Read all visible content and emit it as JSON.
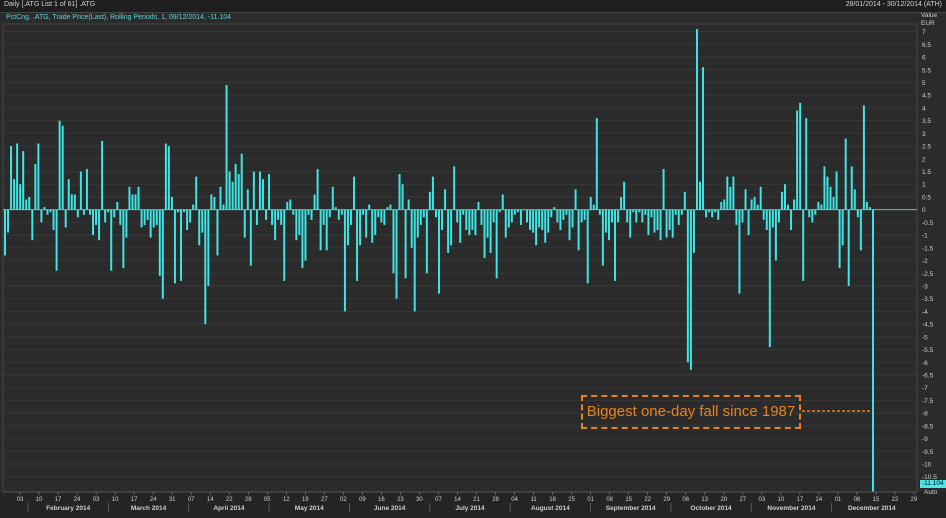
{
  "header": {
    "left": "Daily [.ATG List 1 of 61] .ATG",
    "right": "28/01/2014 - 30/12/2014 (ATH)"
  },
  "subtitle": "PctCng, .ATG, Trade Price(Last), Rolling Periods, 1, 09/12/2014, -11.104",
  "annotation": "Biggest one-day fall since 1987",
  "value_badge": "-11.104",
  "auto_label": "Auto",
  "colors": {
    "bar": "#3ee6e6",
    "background": "#2b2b2b",
    "grid": "#3a3a3a",
    "annotation": "#e8821e"
  },
  "chart_data": {
    "type": "bar",
    "ylabel": "Value EUR",
    "ylim": [
      -11.1,
      7.3
    ],
    "yticks": [
      7,
      6.5,
      6,
      5.5,
      5,
      4.5,
      4,
      3.5,
      3,
      2.5,
      2,
      1.5,
      1,
      0.5,
      0,
      -0.5,
      -1,
      -1.5,
      -2,
      -2.5,
      -3,
      -3.5,
      -4,
      -4.5,
      -5,
      -5.5,
      -6,
      -6.5,
      -7,
      -7.5,
      -8,
      -8.5,
      -9,
      -9.5,
      -10,
      -10.5
    ],
    "day_ticks": [
      "03",
      "10",
      "17",
      "24",
      "03",
      "10",
      "17",
      "24",
      "31",
      "07",
      "14",
      "22",
      "28",
      "05",
      "12",
      "19",
      "27",
      "02",
      "09",
      "16",
      "23",
      "30",
      "07",
      "14",
      "21",
      "28",
      "04",
      "11",
      "18",
      "25",
      "01",
      "08",
      "15",
      "22",
      "29",
      "06",
      "13",
      "20",
      "27",
      "03",
      "10",
      "17",
      "24",
      "01",
      "08",
      "15",
      "22",
      "29"
    ],
    "months": [
      "February 2014",
      "March 2014",
      "April 2014",
      "May 2014",
      "June 2014",
      "July 2014",
      "August 2014",
      "September 2014",
      "October 2014",
      "November 2014",
      "December 2014"
    ],
    "values": [
      -1.8,
      -0.9,
      2.5,
      1.2,
      2.6,
      1.0,
      2.3,
      0.4,
      0.5,
      -1.2,
      1.8,
      2.6,
      -0.5,
      0.1,
      -0.2,
      -0.1,
      -0.8,
      -2.4,
      3.5,
      3.3,
      -0.7,
      1.2,
      0.6,
      0.6,
      -0.3,
      1.5,
      -0.2,
      1.6,
      -0.2,
      -1.0,
      -0.6,
      -1.2,
      2.7,
      -0.5,
      -0.1,
      -2.4,
      -0.3,
      0.3,
      -0.6,
      -2.3,
      -1.1,
      0.9,
      0.6,
      0.6,
      0.9,
      -0.7,
      -0.6,
      -0.4,
      -1.1,
      -0.7,
      -0.6,
      -2.6,
      -3.5,
      2.6,
      2.5,
      0.5,
      -2.9,
      -0.1,
      -2.8,
      -0.1,
      -0.8,
      -0.5,
      0.2,
      1.3,
      -1.4,
      -0.9,
      -4.5,
      -3.0,
      0.6,
      0.5,
      -1.8,
      0.9,
      0.2,
      4.9,
      1.5,
      1.1,
      1.8,
      1.4,
      2.2,
      -1.1,
      0.8,
      -2.2,
      1.5,
      -0.6,
      1.5,
      1.2,
      -0.4,
      1.4,
      -0.6,
      -1.2,
      -0.4,
      -0.6,
      -2.8,
      0.3,
      0.4,
      -0.2,
      -1.2,
      -1.0,
      -2.3,
      -2.0,
      -0.2,
      -0.4,
      0.6,
      1.6,
      -1.6,
      -0.6,
      -1.6,
      -0.3,
      0.9,
      0.1,
      -0.4,
      -0.2,
      -4.0,
      -1.4,
      -0.6,
      1.3,
      -2.8,
      -1.4,
      -0.2,
      -1.1,
      0.2,
      -1.3,
      -1.0,
      -0.3,
      -0.5,
      -0.6,
      0.1,
      0.2,
      -2.5,
      -3.5,
      1.4,
      1.0,
      -2.7,
      0.4,
      -1.5,
      -4.0,
      -1.1,
      -0.6,
      -0.3,
      -2.5,
      0.7,
      1.3,
      -0.3,
      -3.3,
      -0.8,
      0.8,
      -1.7,
      -1.4,
      1.7,
      -0.5,
      -1.3,
      -0.2,
      -0.8,
      -1.0,
      -0.8,
      -1.0,
      0.3,
      -0.6,
      -1.9,
      -1.1,
      -1.7,
      -0.5,
      -2.7,
      -0.1,
      0.6,
      -1.1,
      -0.7,
      -0.5,
      -0.2,
      -0.1,
      -0.6,
      0.0,
      -0.5,
      -0.8,
      -0.9,
      -1.4,
      -0.7,
      -0.8,
      -1.3,
      -0.9,
      -0.3,
      0.1,
      -0.5,
      -0.8,
      -0.4,
      -0.2,
      -1.2,
      -0.7,
      0.8,
      -1.6,
      -0.5,
      -0.4,
      -2.9,
      0.5,
      0.2,
      3.6,
      -0.2,
      -2.2,
      -0.9,
      -1.2,
      -0.5,
      -2.8,
      -0.5,
      0.5,
      1.1,
      -0.5,
      -1.1,
      -0.1,
      -0.5,
      -0.1,
      -0.5,
      -0.2,
      -1.0,
      -0.3,
      -0.9,
      -0.8,
      -1.2,
      1.6,
      -1.1,
      -0.8,
      -1.1,
      -0.2,
      -0.6,
      -0.2,
      0.7,
      -6.0,
      -6.3,
      -1.7,
      7.1,
      1.1,
      5.6,
      -0.3,
      -0.1,
      -0.3,
      -0.1,
      -0.4,
      0.3,
      0.4,
      1.3,
      0.9,
      1.3,
      -0.6,
      -3.3,
      -0.5,
      0.8,
      -1.0,
      0.4,
      0.5,
      0.2,
      0.9,
      -0.4,
      -0.8,
      -5.4,
      -0.7,
      -2.0,
      -0.5,
      0.7,
      1.0,
      0.2,
      -0.8,
      0.4,
      3.9,
      4.2,
      -2.8,
      3.6,
      -0.3,
      -0.5,
      -0.2,
      0.3,
      0.2,
      1.7,
      1.3,
      0.9,
      0.5,
      1.5,
      -2.3,
      -1.4,
      2.8,
      -3.0,
      1.7,
      0.8,
      -0.3,
      -1.6,
      4.1,
      0.3,
      0.1,
      -11.1
    ]
  }
}
